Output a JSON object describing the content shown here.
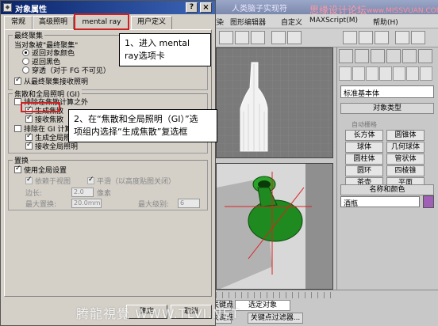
{
  "app": {
    "title": "人类脑子实现符",
    "watermark_top": "思缘设计论坛",
    "watermark_url": "www.MISSVUAN.COM",
    "menu": [
      "渲染",
      "图形编辑器",
      "自定义",
      "MAXScript(M)",
      "帮助(H)"
    ],
    "command_panel": {
      "category": "标准基本体",
      "object_type_title": "对象类型",
      "autogrid": "自动栅格",
      "primitives": [
        "长方体",
        "圆锥体",
        "球体",
        "几何球体",
        "圆柱体",
        "管状体",
        "圆环",
        "四棱锥",
        "茶壶",
        "平面"
      ],
      "name_color_title": "名称和颜色",
      "object_name": "酒瓶"
    },
    "status": {
      "set_key": "设置关键点",
      "set_key_btn": "关键点",
      "selection": "选定对象",
      "key_filters": "关键点过滤器..."
    }
  },
  "dialog": {
    "title": "对象属性",
    "help": "?",
    "close": "×",
    "tabs": [
      "常规",
      "高级照明",
      "mental ray",
      "用户定义"
    ],
    "final_gather": {
      "title": "最终聚集",
      "when_label": "当对象被\"最终聚集\"",
      "options": [
        "返回对象颜色",
        "返回黑色",
        "穿透（对于 FG 不可见）"
      ],
      "receive": "从最终聚集接收照明"
    },
    "caustics_gi": {
      "title": "焦散和全局照明 (GI)",
      "exclude_caustics": "排除在焦散计算之外",
      "generate_caustics": "生成焦散",
      "receive_caustics": "接收焦散",
      "exclude_gi": "排除在 GI 计算之外",
      "generate_gi": "生成全局照明",
      "receive_gi": "接收全局照明"
    },
    "displacement": {
      "title": "置换",
      "use_global": "使用全局设置",
      "view_dependent": "依赖于视图",
      "smoothing": "平滑（以高度贴图关闭）",
      "edge_length_label": "边长:",
      "edge_length_value": "2.0",
      "edge_length_unit": "像素",
      "max_displace_label": "最大置换:",
      "max_displace_value": "20.0mm",
      "max_level_label": "最大级别:",
      "max_level_value": "6"
    },
    "ok": "确定",
    "cancel": "取消"
  },
  "callouts": {
    "step1": "1、进入 mental ray选项卡",
    "step2_line1": "2、在“焦散和全局照明（GI）”选",
    "step2_line2": "项组内选择“生成焦散”复选框"
  },
  "watermark_bottom": "腾龍視覺 WWW.TLVI.NET"
}
